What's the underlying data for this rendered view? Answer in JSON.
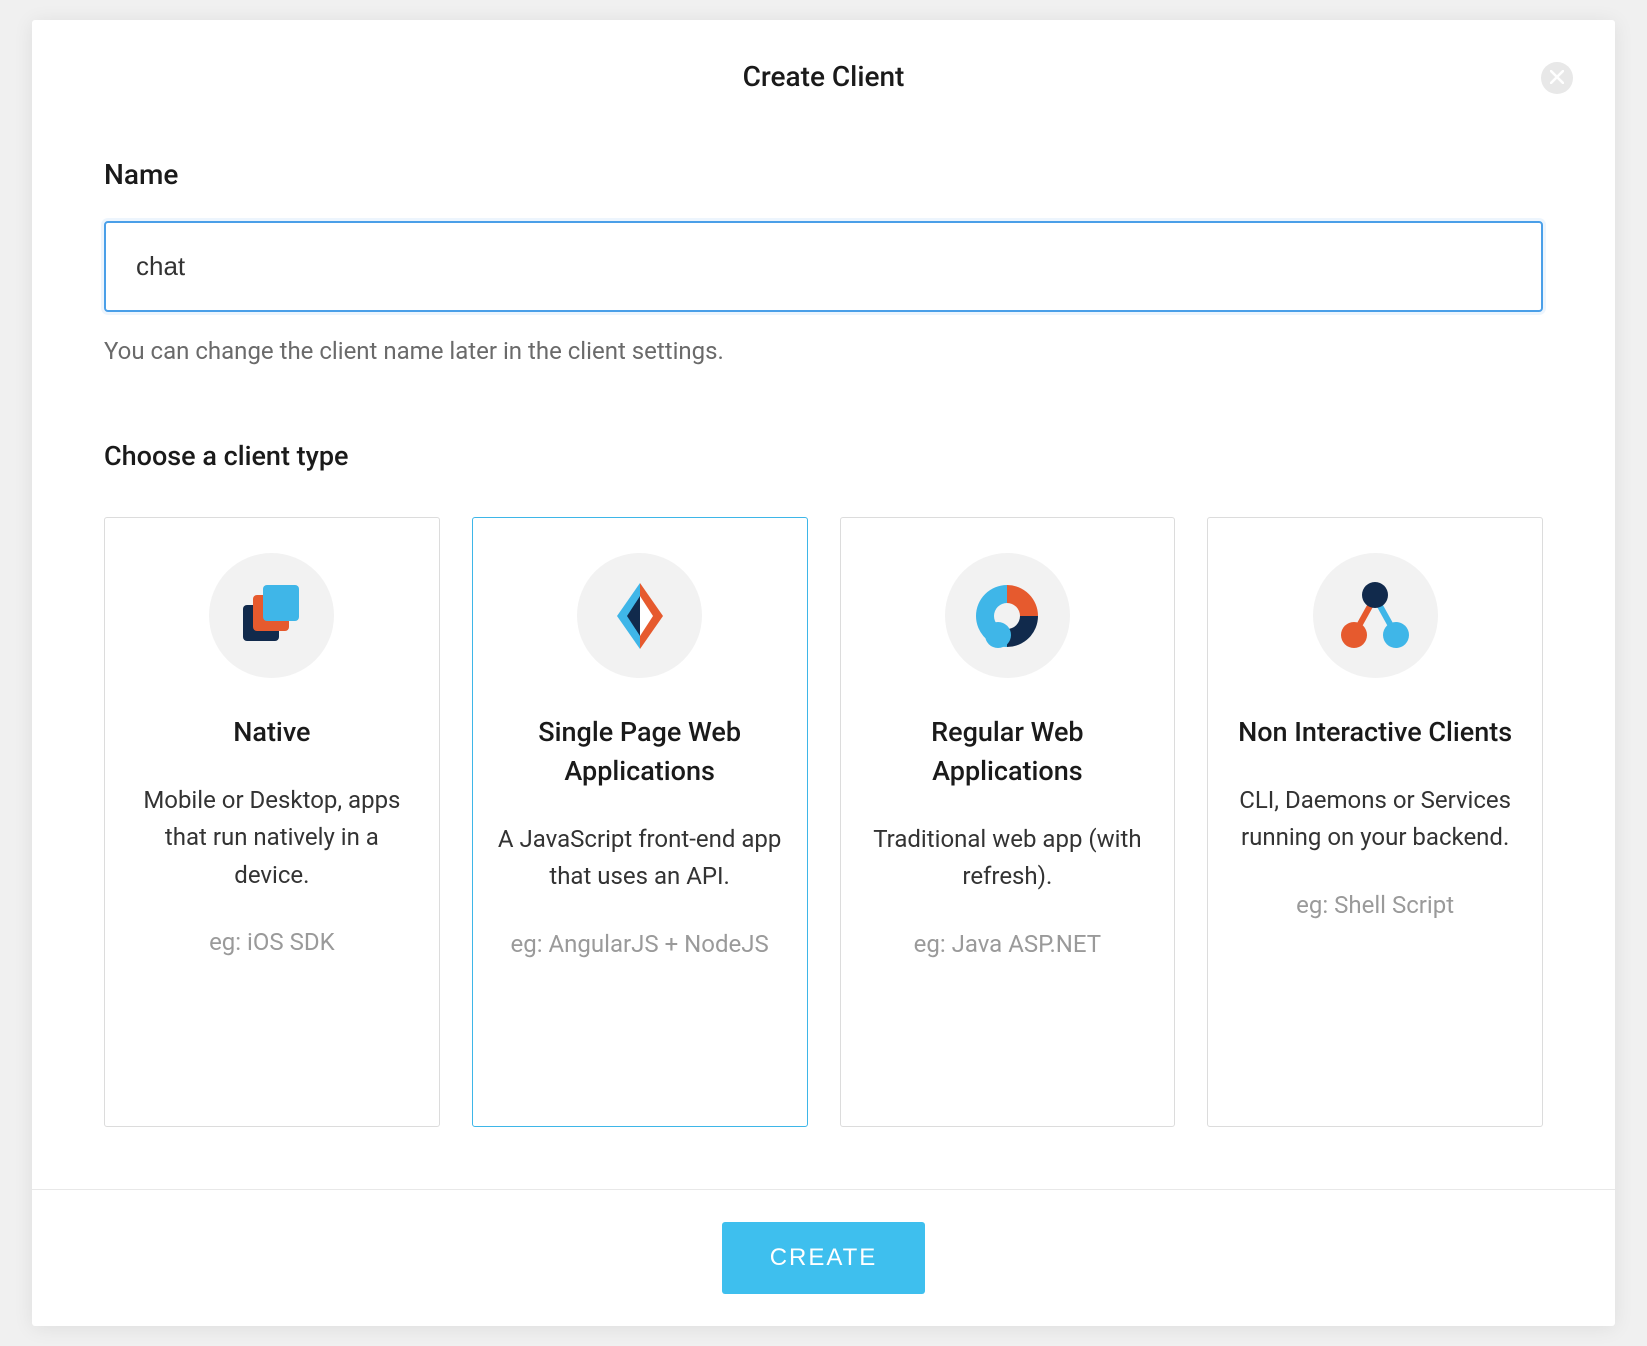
{
  "modal": {
    "title": "Create Client",
    "close_icon": "close"
  },
  "form": {
    "name_label": "Name",
    "name_value": "chat",
    "helper": "You can change the client name later in the client settings.",
    "type_label": "Choose a client type"
  },
  "types": [
    {
      "id": "native",
      "icon": "native-icon",
      "title": "Native",
      "desc": "Mobile or Desktop, apps that run natively in a device.",
      "example": "eg: iOS SDK",
      "selected": false
    },
    {
      "id": "spa",
      "icon": "spa-icon",
      "title": "Single Page Web Applications",
      "desc": "A JavaScript front-end app that uses an API.",
      "example": "eg: AngularJS + NodeJS",
      "selected": true
    },
    {
      "id": "regular",
      "icon": "regular-web-icon",
      "title": "Regular Web Applications",
      "desc": "Traditional web app (with refresh).",
      "example": "eg: Java ASP.NET",
      "selected": false
    },
    {
      "id": "noninteractive",
      "icon": "non-interactive-icon",
      "title": "Non Interactive Clients",
      "desc": "CLI, Daemons or Services running on your backend.",
      "example": "eg: Shell Script",
      "selected": false
    }
  ],
  "footer": {
    "create_label": "CREATE"
  },
  "colors": {
    "accent": "#3ebfee",
    "orange": "#e65a2e",
    "navy": "#112a4c",
    "sky": "#3fb6e8"
  }
}
